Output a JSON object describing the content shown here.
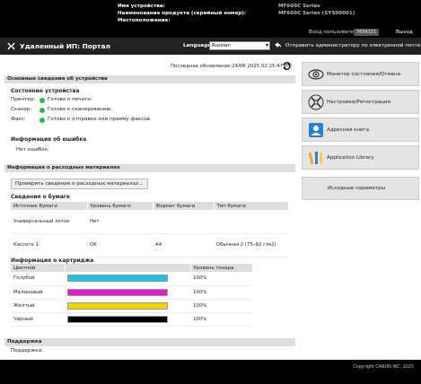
{
  "device": {
    "name_label": "Имя устройства:",
    "name_value": "MF660C Series",
    "product_label": "Наименование продукта (серийный номер):",
    "product_value": "MF660C Series (SYS00001)",
    "location_label": "Местоположение:",
    "location_value": ""
  },
  "user": {
    "login_label": "Вход пользователя:",
    "username": "7654321",
    "logout_label": "Выход"
  },
  "header": {
    "portal_title": "Удаленный ИП: Портал",
    "language_label": "Language:",
    "language_value": "Russian",
    "mail_admin_label": "Отправить администратору по электронной почте"
  },
  "status": {
    "last_update": "Последнее обновление:24/06 2025 02:25:47 PM"
  },
  "basic_info": {
    "section_title": "Основные сведения об устройстве",
    "device_status_title": "Состояние устройства",
    "rows": [
      {
        "label": "Принтер:",
        "value": "Готово к печати.",
        "color": "#2bb84a"
      },
      {
        "label": "Сканер:",
        "value": "Готово к сканированию.",
        "color": "#2bb84a"
      },
      {
        "label": "Факс:",
        "value": "Готово к отправке или приему факсов.",
        "color": "#2bb84a"
      }
    ],
    "error_title": "Информация об ошибке",
    "error_value": "Нет ошибок."
  },
  "consumables": {
    "section_title": "Информация о расходных материалах",
    "check_button": "Проверить сведения о расходных материалах...",
    "paper_title": "Сведения о бумаге",
    "paper_headers": [
      "Источник бумаги",
      "Уровень бумаги",
      "Формат бумаги",
      "Тип бумаги"
    ],
    "paper_rows": [
      [
        "Универсальный лоток",
        "Нет",
        "",
        ""
      ],
      [
        "Кассета 1",
        "OK",
        "A4",
        "Обычная 2 (75–82 г/м2)"
      ]
    ],
    "cartridge_title": "Информация о картридже",
    "cartridge_headers": [
      "Цветной",
      "",
      "Уровень тонера"
    ],
    "cartridge_rows": [
      {
        "name": "Голубой",
        "color": "#1fbfe8",
        "level": "100%"
      },
      {
        "name": "Малиновый",
        "color": "#e31bcb",
        "level": "100%"
      },
      {
        "name": "Желтый",
        "color": "#f6d200",
        "level": "100%"
      },
      {
        "name": "Черный",
        "color": "#000000",
        "level": "100%"
      }
    ]
  },
  "support": {
    "section_title": "Поддержка",
    "link_label": "Поддержка:"
  },
  "menu": {
    "monitor_label": "Монитор состояния/Отмена",
    "settings_label": "Настройки/Регистрация",
    "addressbook_label": "Адресная книга",
    "library_label": "Application Library",
    "default_settings_label": "Исходные параметры"
  },
  "footer": {
    "copyright": "Copyright CANON INC. 2025"
  },
  "colors": {
    "ready_green": "#2bb84a",
    "header_bg": "#000000",
    "section_bg": "#dddddd"
  }
}
